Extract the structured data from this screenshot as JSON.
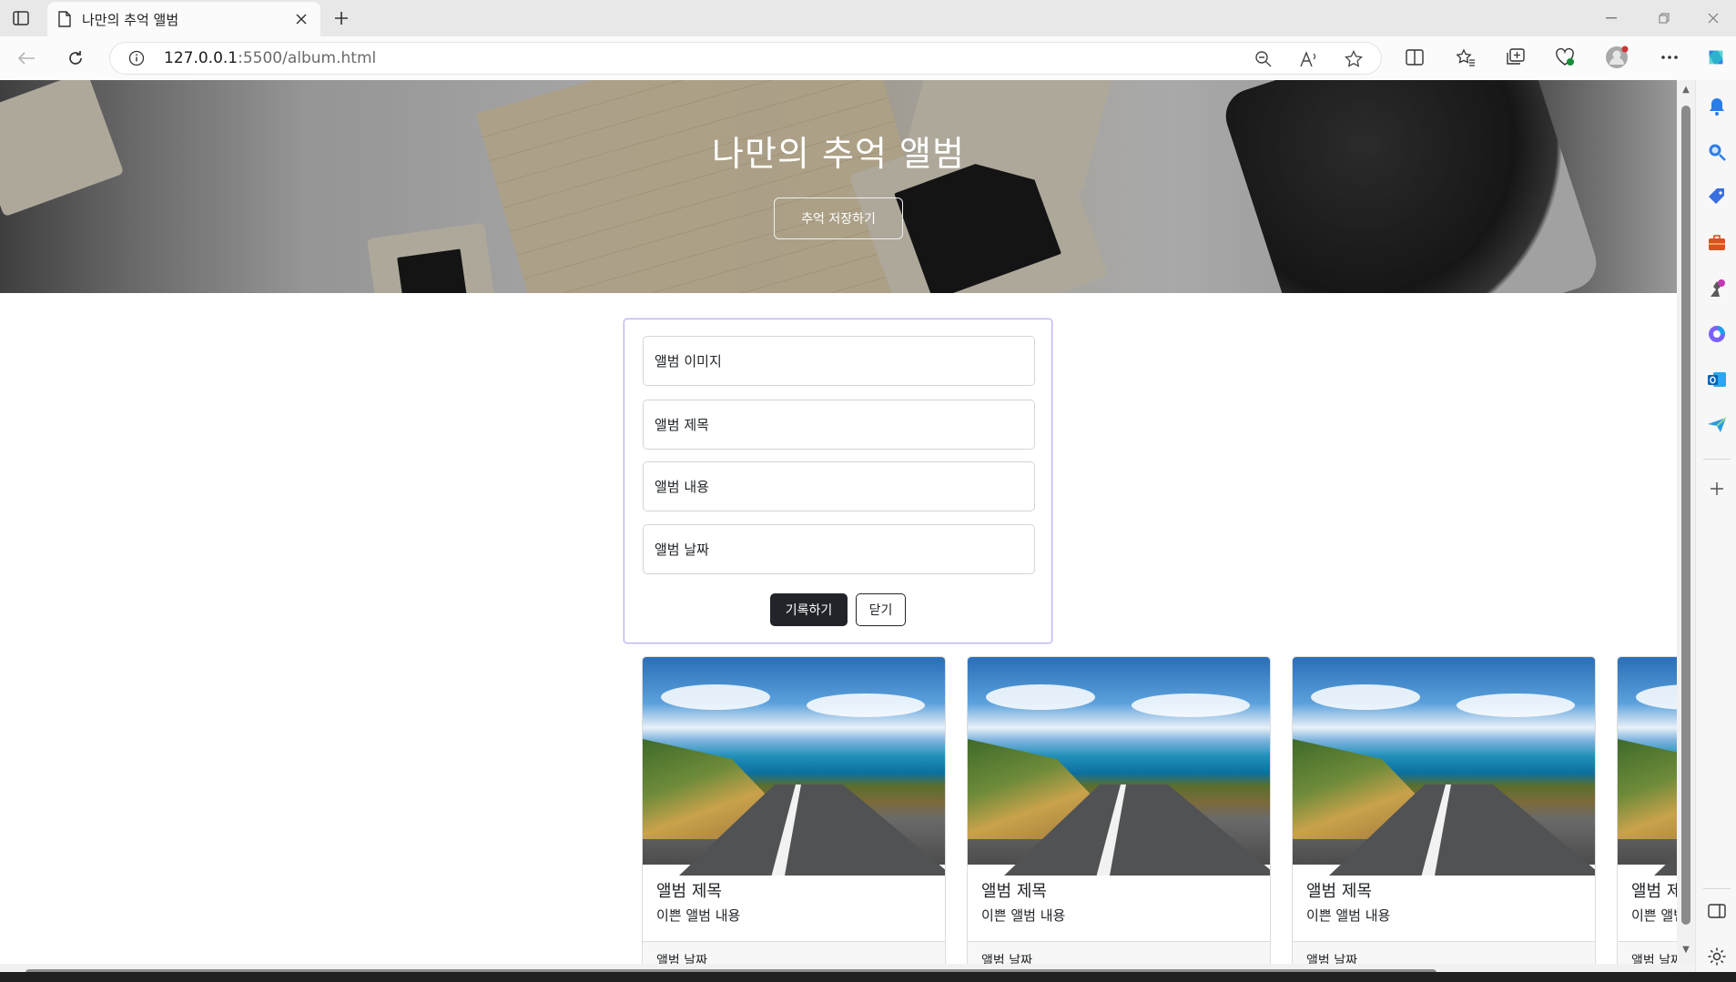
{
  "browser": {
    "tab_title": "나만의 추억 앨범",
    "url_host": "127.0.0.1",
    "url_path": ":5500/album.html"
  },
  "hero": {
    "title": "나만의 추억 앨범",
    "button_label": "추억 저장하기"
  },
  "form": {
    "image_placeholder": "앨범 이미지",
    "title_placeholder": "앨범 제목",
    "content_placeholder": "앨범 내용",
    "date_placeholder": "앨범 날짜",
    "save_label": "기록하기",
    "close_label": "닫기"
  },
  "cards": [
    {
      "title": "앨범 제목",
      "text": "이쁜 앨범 내용",
      "date": "앨범 날짜"
    },
    {
      "title": "앨범 제목",
      "text": "이쁜 앨범 내용",
      "date": "앨범 날짜"
    },
    {
      "title": "앨범 제목",
      "text": "이쁜 앨범 내용",
      "date": "앨범 날짜"
    },
    {
      "title": "앨범 제목",
      "text": "이쁜 앨범 내용",
      "date": "앨범 날짜"
    }
  ],
  "colors": {
    "accent_dark": "#212529",
    "form_border": "#b9b2f0"
  }
}
